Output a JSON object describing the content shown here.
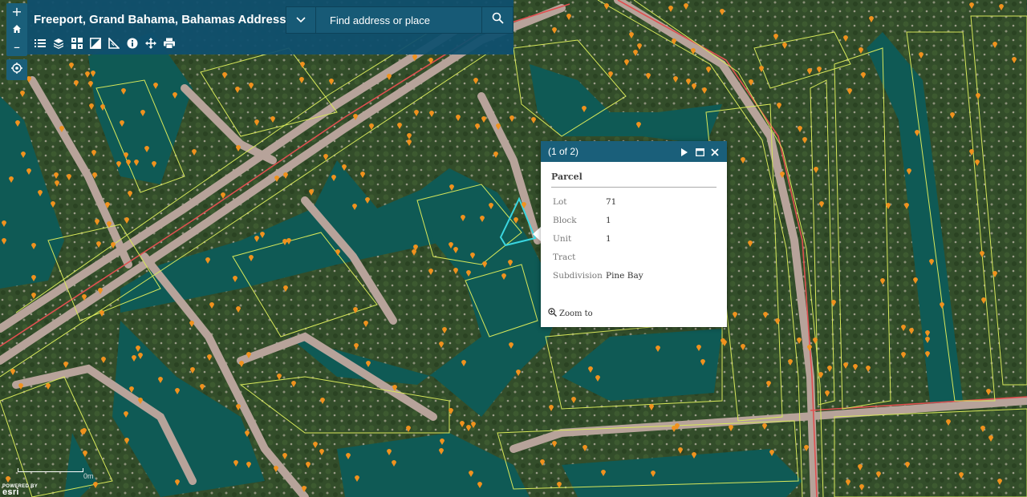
{
  "app": {
    "title": "Freeport, Grand Bahama, Bahamas Addresses"
  },
  "search": {
    "placeholder": "Find address or place"
  },
  "zoom": {
    "in_label": "+",
    "out_label": "–"
  },
  "toolbar": {
    "icons": [
      "legend-icon",
      "layers-icon",
      "basemap-gallery-icon",
      "overview-map-icon",
      "measure-icon",
      "info-icon",
      "move-icon",
      "print-icon"
    ]
  },
  "popup": {
    "count": "(1 of 2)",
    "title": "Parcel",
    "attributes": [
      {
        "key": "Lot",
        "value": "71"
      },
      {
        "key": "Block",
        "value": "1"
      },
      {
        "key": "Unit",
        "value": "1"
      },
      {
        "key": "Tract",
        "value": ""
      },
      {
        "key": "Subdivision",
        "value": "Pine Bay"
      }
    ],
    "zoom_to": "Zoom to"
  },
  "scale": {
    "label": "0m"
  },
  "attribution": {
    "powered": "POWERED BY",
    "brand": "esri"
  },
  "colors": {
    "accent": "#1a5f7a",
    "parcel_line": "#d8e85a",
    "road_line": "#e05050",
    "selection": "#3ad6e0",
    "water": "#0f5a55",
    "pin": "#f0921e"
  }
}
